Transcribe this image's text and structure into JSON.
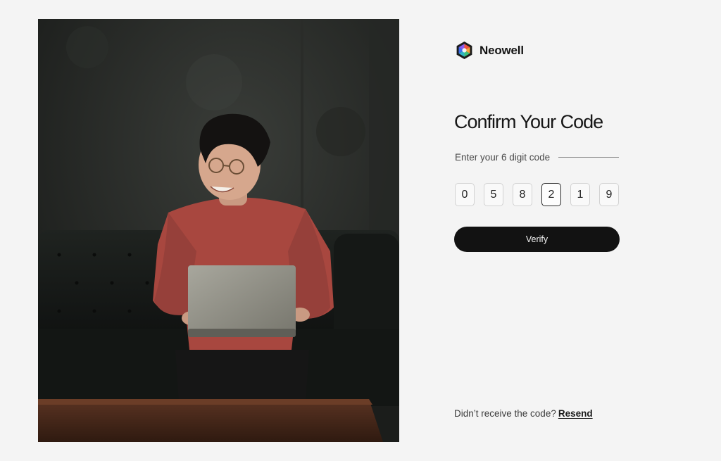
{
  "brand": {
    "name": "Neowell",
    "logo_icon": "hexagon-logo-icon"
  },
  "photo": {
    "icon": "person-with-laptop-photo"
  },
  "form": {
    "title": "Confirm Your Code",
    "code_label": "Enter your 6 digit code",
    "code_digits": [
      "0",
      "5",
      "8",
      "2",
      "1",
      "9"
    ],
    "active_digit_index": 3,
    "verify_label": "Verify",
    "resend_prompt": "Didn’t receive the code?",
    "resend_label": "Resend"
  },
  "colors": {
    "page_background": "#f4f4f4",
    "button_background": "#121212",
    "button_text": "#f4f4f4",
    "logo_red": "#f0523e",
    "logo_green": "#3fc27a",
    "logo_blue": "#3d6ef0"
  }
}
